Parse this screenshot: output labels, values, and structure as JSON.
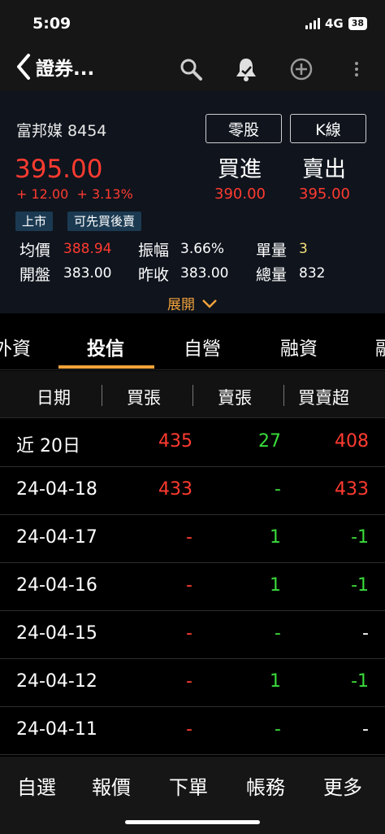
{
  "status_bar": {
    "time": "5:09",
    "network": "4G",
    "battery": "38"
  },
  "nav": {
    "title": "證券..."
  },
  "stock": {
    "name": "富邦媒 8454",
    "odd_lot_label": "零股",
    "kline_label": "K線",
    "price": "395.00",
    "change": "+ 12.00",
    "change_pct": "+ 3.13%",
    "bid_label": "買進",
    "bid": "390.00",
    "ask_label": "賣出",
    "ask": "395.00",
    "tags": [
      "上市",
      "可先買後賣"
    ],
    "stats": {
      "avg_label": "均價",
      "avg": "388.94",
      "amp_label": "振幅",
      "amp": "3.66%",
      "unit_label": "單量",
      "unit": "3",
      "open_label": "開盤",
      "open": "383.00",
      "prev_label": "昨收",
      "prev": "383.00",
      "total_label": "總量",
      "total": "832"
    },
    "expand_label": "展開"
  },
  "tabs": [
    "外資",
    "投信",
    "自營",
    "融資",
    "融"
  ],
  "table": {
    "headers": [
      "日期",
      "買張",
      "賣張",
      "買賣超"
    ],
    "rows": [
      {
        "date": "近 20日",
        "buy": "435",
        "sell": "27",
        "net": "408"
      },
      {
        "date": "24-04-18",
        "buy": "433",
        "sell": "-",
        "net": "433"
      },
      {
        "date": "24-04-17",
        "buy": "-",
        "sell": "1",
        "net": "-1"
      },
      {
        "date": "24-04-16",
        "buy": "-",
        "sell": "1",
        "net": "-1"
      },
      {
        "date": "24-04-15",
        "buy": "-",
        "sell": "-",
        "net": "-"
      },
      {
        "date": "24-04-12",
        "buy": "-",
        "sell": "1",
        "net": "-1"
      },
      {
        "date": "24-04-11",
        "buy": "-",
        "sell": "-",
        "net": "-"
      }
    ]
  },
  "bottom_nav": [
    "自選",
    "報價",
    "下單",
    "帳務",
    "更多"
  ],
  "colors": {
    "up": "#ff3b30",
    "down": "#3adb3a",
    "neutral": "#ffffff",
    "accent": "#f2a23a",
    "unit": "#f3e27a"
  },
  "icons": [
    "back-chevron-icon",
    "search-icon",
    "bell-icon",
    "add-circle-icon",
    "more-vertical-icon",
    "chevron-down-icon"
  ]
}
